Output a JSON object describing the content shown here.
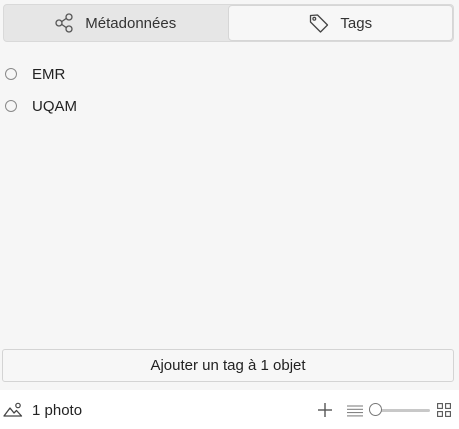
{
  "tabs": [
    {
      "label": "Métadonnées",
      "icon": "share-icon",
      "active": false
    },
    {
      "label": "Tags",
      "icon": "tag-icon",
      "active": true
    }
  ],
  "tags": [
    {
      "label": "EMR",
      "selected": false
    },
    {
      "label": "UQAM",
      "selected": false
    }
  ],
  "add_tag_label": "Ajouter un tag à 1 objet",
  "status": {
    "photo_count": "1 photo",
    "zoom_level": 0.05
  }
}
